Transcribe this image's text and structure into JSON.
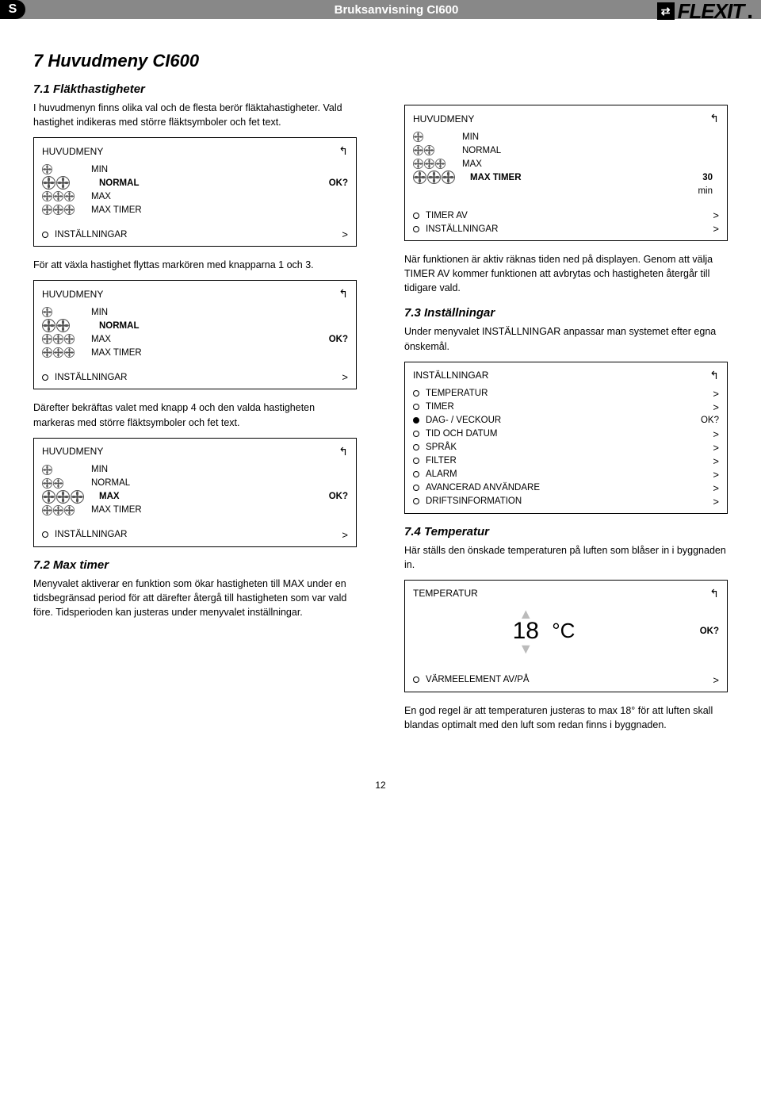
{
  "band": {
    "cap": "S",
    "title": "Bruksanvisning CI600",
    "brand": "FLEXIT"
  },
  "h1": "7   Huvudmeny CI600",
  "left": {
    "s71": {
      "heading": "7.1   Fläkthastigheter",
      "p1": "I huvudmenyn finns olika val och de flesta berör fläktahastigheter. Vald hastighet indikeras med större fläktsymboler och fet text.",
      "p2": "För att växla hastighet flyttas markören med knapparna 1 och 3.",
      "p3": "Därefter bekräftas valet med knapp 4 och den valda hastigheten markeras med större fläktsymboler och fet text."
    },
    "s72": {
      "heading": "7.2   Max timer",
      "p1": "Menyvalet aktiverar en funktion som ökar hastigheten till MAX under en tidsbegränsad period för att därefter återgå till hastigheten som var vald före. Tidsperioden kan justeras under menyvalet inställningar."
    }
  },
  "right": {
    "p_after_timer": "När funktionen är aktiv räknas tiden ned på displayen. Genom att välja TIMER AV kommer funktionen att avbrytas och hastigheten återgår till tidigare vald.",
    "s73": {
      "heading": "7.3   Inställningar",
      "p1": "Under menyvalet INSTÄLLNINGAR anpassar man systemet efter egna önskemål."
    },
    "s74": {
      "heading": "7.4   Temperatur",
      "p1": "Här ställs den önskade temperaturen på luften som blåser in i byggnaden in.",
      "p2": "En god regel är att temperaturen justeras to max 18° för att luften skall blandas optimalt med den luft som redan finns i byggnaden."
    }
  },
  "screens": {
    "huvudmeny": "HUVUDMENY",
    "min": "MIN",
    "normal": "NORMAL",
    "max": "MAX",
    "maxtimer": "MAX TIMER",
    "ok": "OK?",
    "installningar": "INSTÄLLNINGAR",
    "timer_val": "30",
    "timer_unit": "min",
    "timer_av": "TIMER AV",
    "settings_title": "INSTÄLLNINGAR",
    "s_temp": "TEMPERATUR",
    "s_timer": "TIMER",
    "s_dag": "DAG- / VECKOUR",
    "s_tid": "TID OCH DATUM",
    "s_sprak": "SPRÅK",
    "s_filter": "FILTER",
    "s_alarm": "ALARM",
    "s_adv": "AVANCERAD ANVÄNDARE",
    "s_drift": "DRIFTSINFORMATION",
    "temp_title": "TEMPERATUR",
    "temp_val": "18",
    "temp_unit": "°C",
    "varme": "VÄRMEELEMENT AV/PÅ"
  },
  "pagenum": "12"
}
